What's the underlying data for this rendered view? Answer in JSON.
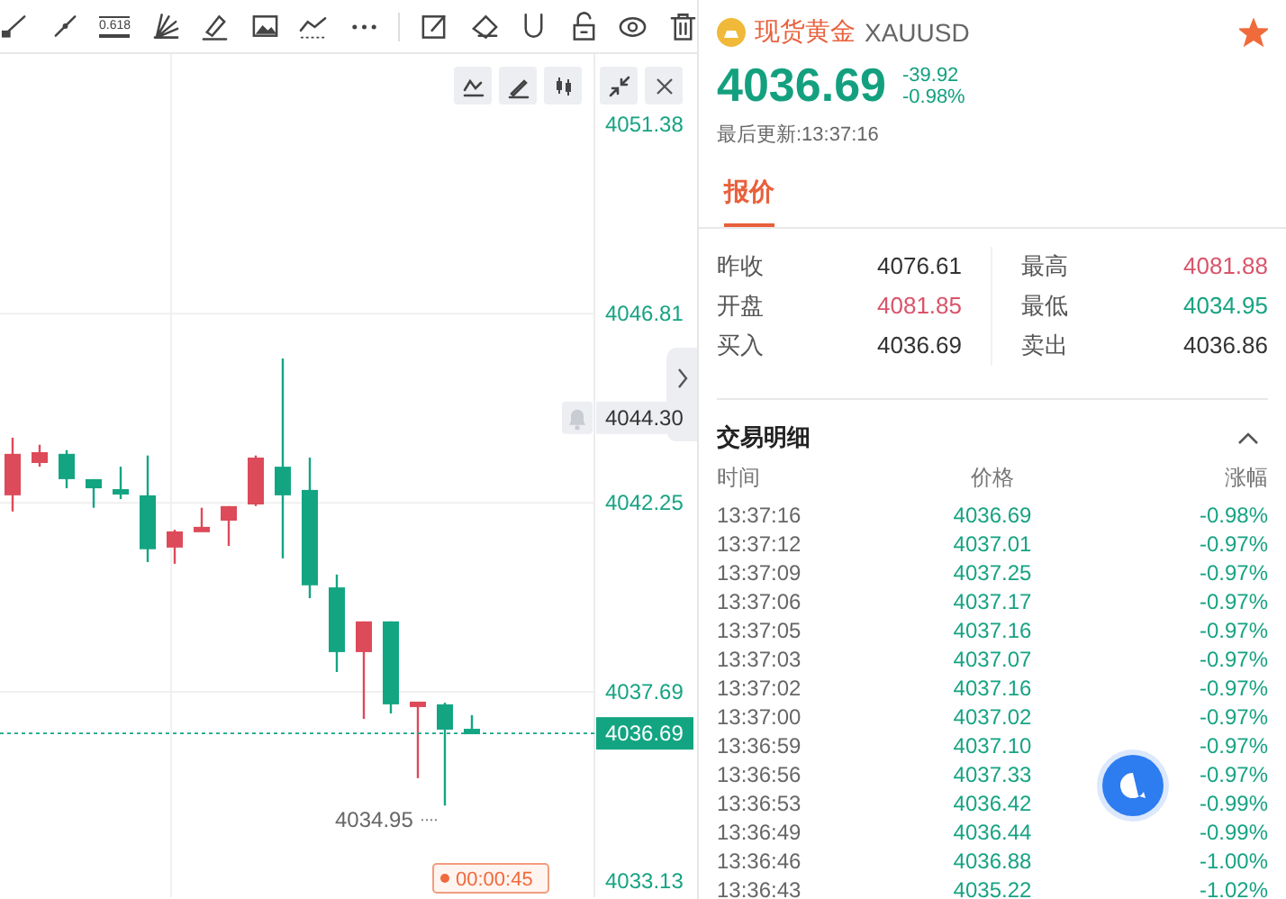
{
  "toolbar": {
    "fib_label": "0.618"
  },
  "chart": {
    "chart_data": {
      "type": "candlestick",
      "categories": [
        null,
        null,
        null,
        null,
        null,
        null,
        null,
        null,
        null,
        null,
        null,
        null,
        null,
        null,
        null,
        null,
        null,
        null
      ],
      "ohlc": [
        [
          4042.43,
          4043.82,
          4042.04,
          4043.43
        ],
        [
          4043.21,
          4043.65,
          4043.12,
          4043.47
        ],
        [
          4043.43,
          4043.52,
          4042.6,
          4042.82
        ],
        [
          4042.82,
          4042.82,
          4042.13,
          4042.6
        ],
        [
          4042.56,
          4043.12,
          4042.34,
          4042.47
        ],
        [
          4042.43,
          4043.39,
          4040.82,
          4041.13
        ],
        [
          4041.17,
          4041.6,
          4040.78,
          4041.56
        ],
        [
          4041.56,
          4042.13,
          4041.56,
          4041.65
        ],
        [
          4041.82,
          4042.17,
          4041.21,
          4042.17
        ],
        [
          4042.21,
          4043.39,
          4042.17,
          4043.34
        ],
        [
          4043.12,
          4045.73,
          4040.91,
          4042.43
        ],
        [
          4042.56,
          4043.34,
          4039.95,
          4040.26
        ],
        [
          4040.21,
          4040.52,
          4038.17,
          4038.65
        ],
        [
          4038.65,
          4039.39,
          4037.04,
          4039.39
        ],
        [
          4039.39,
          4039.39,
          4037.17,
          4037.39
        ],
        [
          4037.35,
          4037.43,
          4035.61,
          4037.43
        ],
        [
          4037.39,
          4037.43,
          4034.95,
          4036.78
        ],
        [
          4036.78,
          4037.13,
          4036.69,
          4036.69
        ]
      ],
      "ylim": [
        4032.74,
        4053.07
      ],
      "grid": true,
      "yticks": [
        {
          "value": 4051.38,
          "label": "4051.38"
        },
        {
          "value": 4046.81,
          "label": "4046.81"
        },
        {
          "value": 4042.25,
          "label": "4042.25"
        },
        {
          "value": 4037.69,
          "label": "4037.69"
        },
        {
          "value": 4033.13,
          "label": "4033.13"
        }
      ]
    },
    "current_price": "4036.69",
    "hover_price": "4044.30",
    "low_marker": "4034.95",
    "countdown": "00:00:45"
  },
  "quote": {
    "name": "现货黄金",
    "symbol": "XAUUSD",
    "favorite": true,
    "price": "4036.69",
    "change": "-39.92",
    "change_pct": "-0.98%",
    "updated": "最后更新:13:37:16"
  },
  "tabs": [
    {
      "label": "报价",
      "selected": true
    }
  ],
  "stats": [
    {
      "label": "昨收",
      "value": "4076.61",
      "color": "#333333"
    },
    {
      "label": "最高",
      "value": "4081.88",
      "color": "#d9546a"
    },
    {
      "label": "开盘",
      "value": "4081.85",
      "color": "#d9546a"
    },
    {
      "label": "最低",
      "value": "4034.95",
      "color": "#17a383"
    },
    {
      "label": "买入",
      "value": "4036.69",
      "color": "#333333"
    },
    {
      "label": "卖出",
      "value": "4036.86",
      "color": "#333333"
    }
  ],
  "trades": {
    "title": "交易明细",
    "expanded": true,
    "columns": [
      "时间",
      "价格",
      "涨幅"
    ],
    "rows": [
      [
        "13:37:16",
        "4036.69",
        "-0.98%"
      ],
      [
        "13:37:12",
        "4037.01",
        "-0.97%"
      ],
      [
        "13:37:09",
        "4037.25",
        "-0.97%"
      ],
      [
        "13:37:06",
        "4037.17",
        "-0.97%"
      ],
      [
        "13:37:05",
        "4037.16",
        "-0.97%"
      ],
      [
        "13:37:03",
        "4037.07",
        "-0.97%"
      ],
      [
        "13:37:02",
        "4037.16",
        "-0.97%"
      ],
      [
        "13:37:00",
        "4037.02",
        "-0.97%"
      ],
      [
        "13:36:59",
        "4037.10",
        "-0.97%"
      ],
      [
        "13:36:56",
        "4037.33",
        "-0.97%"
      ],
      [
        "13:36:53",
        "4036.42",
        "-0.99%"
      ],
      [
        "13:36:49",
        "4036.44",
        "-0.99%"
      ],
      [
        "13:36:46",
        "4036.88",
        "-1.00%"
      ],
      [
        "13:36:43",
        "4035.22",
        "-1.02%"
      ]
    ]
  }
}
